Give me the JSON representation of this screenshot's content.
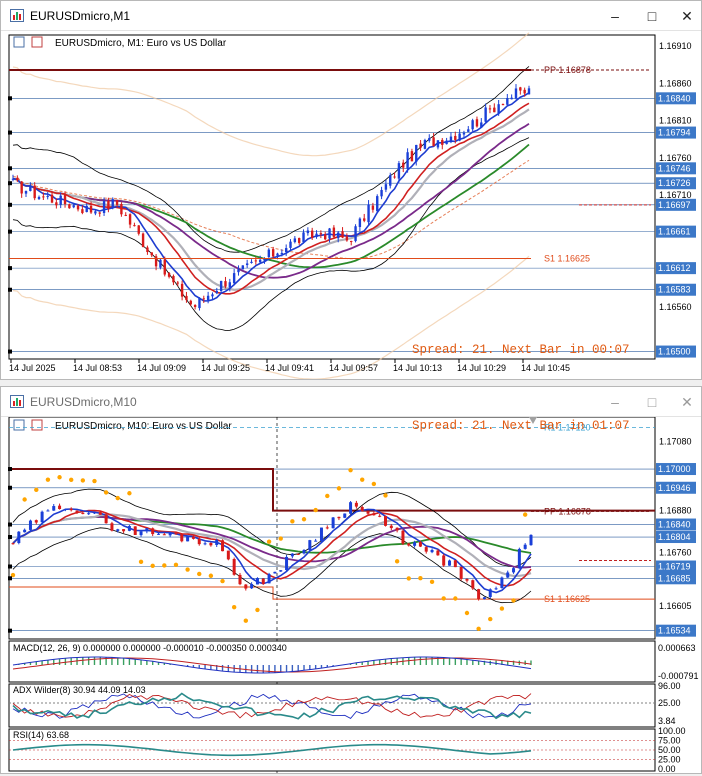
{
  "window1": {
    "title": "EURUSDmicro,M1",
    "header": "EURUSDmicro, M1:  Euro vs US Dollar",
    "spread": "Spread: 21. Next Bar in 00:07",
    "pivot": "PP 1.16878",
    "support": "S1 1.16625",
    "price_labels": [
      "1.16910",
      "1.16860",
      "1.16840",
      "1.16810",
      "1.16794",
      "1.16760",
      "1.16746",
      "1.16726",
      "1.16710",
      "1.16697",
      "1.16661",
      "1.16612",
      "1.16583",
      "1.16560",
      "1.16500"
    ],
    "time_labels": [
      "14 Jul 2025",
      "14 Jul 08:53",
      "14 Jul 09:09",
      "14 Jul 09:25",
      "14 Jul 09:41",
      "14 Jul 09:57",
      "14 Jul 10:13",
      "14 Jul 10:29",
      "14 Jul 10:45"
    ]
  },
  "window2": {
    "title": "EURUSDmicro,M10",
    "header": "EURUSDmicro, M10:  Euro vs US Dollar",
    "spread": "Spread: 21. Next Bar in 01:07",
    "resistance": "R1 1.17120",
    "pivot": "PP 1.16878",
    "support": "S1 1.16625",
    "price_labels": [
      "1.17080",
      "1.17000",
      "1.16946",
      "1.16880",
      "1.16840",
      "1.16804",
      "1.16760",
      "1.16719",
      "1.16685",
      "1.16605",
      "1.16534"
    ],
    "macd_label": "MACD(12, 26, 9) 0.000000 0.000000 -0.000010 -0.000350 0.000340",
    "macd_scale": [
      "0.000663",
      "-0.000791"
    ],
    "adx_label": "ADX Wilder(8) 30.94 44.09 14.03",
    "adx_scale": [
      "96.00",
      "25.00",
      "3.84"
    ],
    "rsi_label": "RSI(14) 63.68",
    "rsi_scale": [
      "100.00",
      "75.00",
      "50.00",
      "25.00",
      "0.00"
    ]
  },
  "colors": {
    "bull": "#1a3fd8",
    "bear": "#d81a1a",
    "pivot": "#7a0d0d",
    "support": "#e04b1a",
    "info_text": "#e05a12",
    "hline": "#2f5fa0",
    "price_tag": "#3c78c8",
    "ma_green": "#2a8a2a",
    "ma_purple": "#7a2a8a",
    "ma_red": "#d02020",
    "ma_blue": "#1e3cd0",
    "ma_silver": "#b0b0b8",
    "sar": "#ffa500"
  },
  "icons": [
    "chart-window-icon",
    "minimize-icon",
    "maximize-icon",
    "close-icon"
  ]
}
